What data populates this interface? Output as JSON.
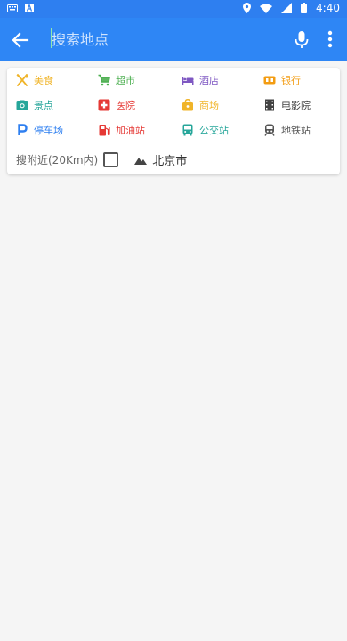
{
  "status_bar": {
    "time": "4:40"
  },
  "search": {
    "placeholder": "搜索地点",
    "value": ""
  },
  "categories": [
    {
      "label": "美食",
      "icon": "fork-knife-icon",
      "color": "#f0b429"
    },
    {
      "label": "超市",
      "icon": "cart-icon",
      "color": "#4caf50"
    },
    {
      "label": "酒店",
      "icon": "bed-icon",
      "color": "#7e57c2"
    },
    {
      "label": "银行",
      "icon": "bank-icon",
      "color": "#f39c12"
    },
    {
      "label": "景点",
      "icon": "camera-icon",
      "color": "#26a69a"
    },
    {
      "label": "医院",
      "icon": "hospital-icon",
      "color": "#e53935"
    },
    {
      "label": "商场",
      "icon": "shopping-bag-icon",
      "color": "#f0b429"
    },
    {
      "label": "电影院",
      "icon": "film-icon",
      "color": "#424242"
    },
    {
      "label": "停车场",
      "icon": "parking-icon",
      "color": "#2e7ff0"
    },
    {
      "label": "加油站",
      "icon": "gas-station-icon",
      "color": "#e53935"
    },
    {
      "label": "公交站",
      "icon": "bus-icon",
      "color": "#26a69a"
    },
    {
      "label": "地铁站",
      "icon": "subway-icon",
      "color": "#555555"
    }
  ],
  "nearby": {
    "label": "搜附近(20Km内)",
    "checked": false
  },
  "city": {
    "name": "北京市"
  }
}
